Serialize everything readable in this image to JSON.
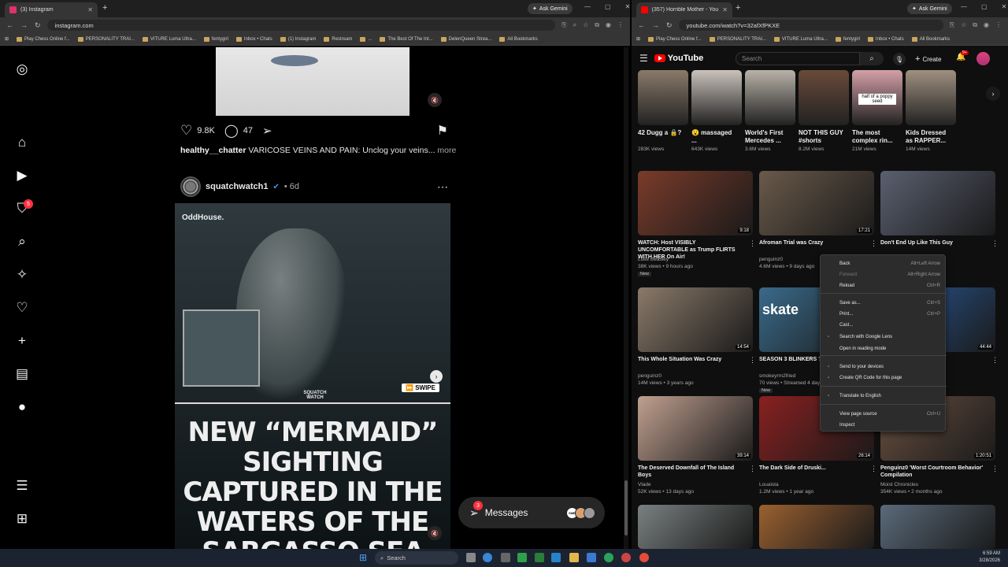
{
  "ig_browser": {
    "tab_title": "(3) Instagram",
    "url": "instagram.com",
    "gemini": "Ask Gemini",
    "bookmarks": [
      "Play Chess Online f...",
      "PERSONALITY TRAI...",
      "VITURE Luma Ultra...",
      "fentygirl",
      "Inbox • Chats",
      "(1) Instagram",
      "Restream",
      "...",
      "The Best Of The Int...",
      "DelenQueen Strea...",
      "All Bookmarks"
    ]
  },
  "instagram": {
    "notif_badge": "5",
    "post1": {
      "likes": "9.8K",
      "comments": "47",
      "caption_user": "healthy__chatter",
      "caption_text": "VARICOSE VEINS AND PAIN: Unclog your veins...",
      "more": "more"
    },
    "post2": {
      "user": "squatchwatch1",
      "time": "• 6d",
      "brand": "OddHouse.",
      "swipe": "SWIPE",
      "headline": "NEW “MERMAID” SIGHTING CAPTURED IN THE WATERS OF THE SARGASSO SEA",
      "squatch": "SQUATCH WATCH"
    },
    "messages": {
      "label": "Messages",
      "badge": "3",
      "avatar_tag": "SME"
    }
  },
  "yt_browser": {
    "tab_title": "(357) Horrible Mother - YouTub",
    "url": "youtube.com/watch?v=32afXfPKXE",
    "gemini": "Ask Gemini",
    "bookmarks": [
      "Play Chess Online f...",
      "PERSONALITY TRAI...",
      "VITURE Luma Ultra...",
      "fentygirl",
      "Inbox • Chats",
      "All Bookmarks"
    ]
  },
  "youtube": {
    "logo": "YouTube",
    "search_placeholder": "Search",
    "create": "Create",
    "notif_badge": "9+",
    "shorts": [
      {
        "title": "42 Dugg a 🔒?",
        "views": "283K views",
        "color": "#8a7a6a",
        "overlay": ""
      },
      {
        "title": "😮 massaged ...",
        "views": "643K views",
        "color": "#c9c2bb",
        "overlay": ""
      },
      {
        "title": "World's First Mercedes ...",
        "views": "3.6M views",
        "color": "#b8b2a8",
        "overlay": ""
      },
      {
        "title": "NOT THIS GUY #shorts",
        "views": "8.2M views",
        "color": "#6a4a3a",
        "overlay": ""
      },
      {
        "title": "The most complex rin...",
        "views": "21M views",
        "color": "#d4a0a8",
        "overlay": "half of a poppy seed"
      },
      {
        "title": "Kids Dressed as RAPPER...",
        "views": "14M views",
        "color": "#a09080",
        "overlay": ""
      }
    ],
    "videos": [
      {
        "title": "WATCH: Host VISIBLY UNCOMFORTABLE as Trump FLIRTS WITH HER On Air!",
        "channel": "Luke Beasley",
        "meta": "38K views • 9 hours ago",
        "duration": "9:18",
        "badge": "New",
        "color": "#7a3b2a"
      },
      {
        "title": "Afroman Trial was Crazy",
        "channel": "penguinz0",
        "meta": "4.6M views • 9 days ago",
        "duration": "17:21",
        "badge": "",
        "color": "#6a5a4a"
      },
      {
        "title": "Don't End Up Like This Guy",
        "channel": "penguinz0",
        "meta": "",
        "duration": "",
        "badge": "",
        "color": "#5a6070"
      },
      {
        "title": "This Whole Situation Was Crazy",
        "channel": "penguinz0",
        "meta": "14M views • 3 years ago",
        "duration": "14:54",
        "badge": "",
        "color": "#8a7a6a"
      },
      {
        "title": "SEASON 3 BLINKERS ?",
        "channel": "smokeyrm2fried",
        "meta": "70 views • Streamed 4 days ago",
        "duration": "",
        "badge": "New",
        "color": "#3a6a8a",
        "thumb_text": "skate"
      },
      {
        "title": "...Thinks He's",
        "channel": "",
        "meta": "",
        "duration": "44:44",
        "badge": "",
        "color": "#2a5a9a"
      },
      {
        "title": "The Deserved Downfall of The Island Boys",
        "channel": "Vlade",
        "meta": "52K views • 13 days ago",
        "duration": "39:14",
        "badge": "",
        "color": "#c0a090"
      },
      {
        "title": "The Dark Side of Druski...",
        "channel": "Louaista",
        "meta": "1.2M views • 1 year ago",
        "duration": "26:14",
        "badge": "",
        "color": "#8a2020"
      },
      {
        "title": "Penguinz0 'Worst Courtroom Behavior' Compilation",
        "channel": "Moist Chronicles",
        "meta": "354K views • 2 months ago",
        "duration": "1:20:51",
        "badge": "",
        "color": "#6a5040"
      }
    ]
  },
  "context_menu": [
    {
      "label": "Back",
      "shortcut": "Alt+Left Arrow",
      "disabled": false
    },
    {
      "label": "Forward",
      "shortcut": "Alt+Right Arrow",
      "disabled": true
    },
    {
      "label": "Reload",
      "shortcut": "Ctrl+R",
      "disabled": false
    },
    {
      "label": "Save as...",
      "shortcut": "Ctrl+S",
      "disabled": false
    },
    {
      "label": "Print...",
      "shortcut": "Ctrl+P",
      "disabled": false
    },
    {
      "label": "Cast...",
      "shortcut": "",
      "disabled": false
    },
    {
      "label": "Search with Google Lens",
      "shortcut": "",
      "disabled": false
    },
    {
      "label": "Open in reading mode",
      "shortcut": "",
      "disabled": false
    },
    {
      "label": "Send to your devices",
      "shortcut": "",
      "disabled": false
    },
    {
      "label": "Create QR Code for this page",
      "shortcut": "",
      "disabled": false
    },
    {
      "label": "Translate to English",
      "shortcut": "",
      "disabled": false
    },
    {
      "label": "View page source",
      "shortcut": "Ctrl+U",
      "disabled": false
    },
    {
      "label": "Inspect",
      "shortcut": "",
      "disabled": false
    }
  ],
  "taskbar": {
    "search": "Search",
    "time": "6:59 AM",
    "date": "3/28/2026"
  }
}
